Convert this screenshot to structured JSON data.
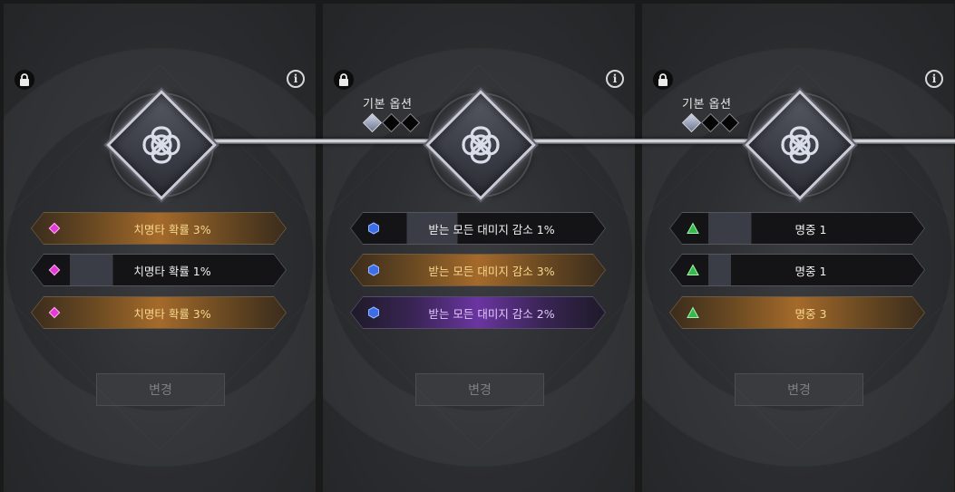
{
  "panels": [
    {
      "show_base": false,
      "base_label": "",
      "options": [
        {
          "text": "치명타 확률 3%",
          "tier": "gold",
          "icon": "pink-diamond-icon"
        },
        {
          "text": "치명타 확률 1%",
          "tier": "grey",
          "icon": "pink-diamond-icon"
        },
        {
          "text": "치명타 확률 3%",
          "tier": "gold",
          "icon": "pink-diamond-icon"
        }
      ],
      "button": "변경"
    },
    {
      "show_base": true,
      "base_label": "기본 옵션",
      "options": [
        {
          "text": "받는 모든 대미지 감소 1%",
          "tier": "grey",
          "icon": "blue-hexagon-icon"
        },
        {
          "text": "받는 모든 대미지 감소 3%",
          "tier": "gold",
          "icon": "blue-hexagon-icon"
        },
        {
          "text": "받는 모든 대미지 감소 2%",
          "tier": "purple",
          "icon": "blue-hexagon-icon"
        }
      ],
      "button": "변경"
    },
    {
      "show_base": true,
      "base_label": "기본 옵션",
      "options": [
        {
          "text": "명중 1",
          "tier": "grey",
          "icon": "green-triangle-icon"
        },
        {
          "text": "명중 1",
          "tier": "grey",
          "icon": "green-triangle-icon"
        },
        {
          "text": "명중 3",
          "tier": "gold",
          "icon": "green-triangle-icon"
        }
      ],
      "button": "변경"
    }
  ],
  "info_symbol": "i",
  "colors": {
    "gold": "#a56a2b",
    "purple": "#6a35a0",
    "pink_icon": "#e23ad6",
    "blue_icon": "#3c6ee8",
    "green_icon": "#37b84a"
  }
}
